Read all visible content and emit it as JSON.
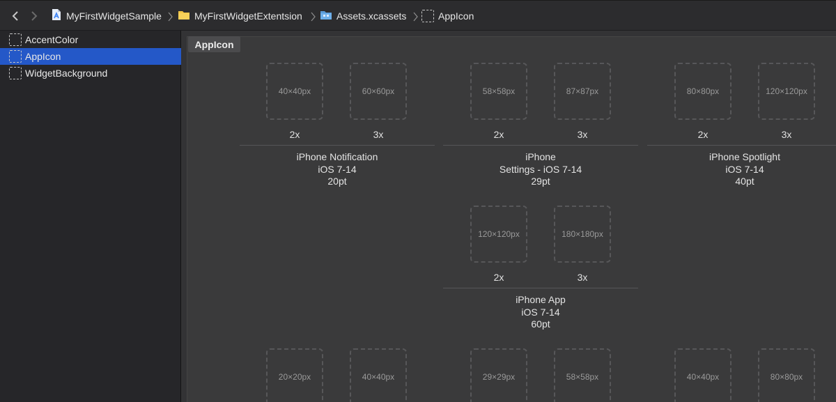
{
  "breadcrumb": {
    "items": [
      {
        "label": "MyFirstWidgetSample",
        "icon": "xcode-project-icon"
      },
      {
        "label": "MyFirstWidgetExtentsion",
        "icon": "folder-icon"
      },
      {
        "label": "Assets.xcassets",
        "icon": "asset-catalog-icon"
      },
      {
        "label": "AppIcon",
        "icon": "appicon-set-icon"
      }
    ]
  },
  "sidebar": {
    "items": [
      {
        "label": "AccentColor",
        "selected": false
      },
      {
        "label": "AppIcon",
        "selected": true
      },
      {
        "label": "WidgetBackground",
        "selected": false
      }
    ]
  },
  "main": {
    "set_title": "AppIcon",
    "groups": [
      {
        "line1": "iPhone Notification",
        "line2": "iOS 7-14",
        "line3": "20pt",
        "slots": [
          {
            "size": "40×40px",
            "scale": "2x"
          },
          {
            "size": "60×60px",
            "scale": "3x"
          }
        ]
      },
      {
        "line1": "iPhone",
        "line2": "Settings - iOS 7-14",
        "line3": "29pt",
        "slots": [
          {
            "size": "58×58px",
            "scale": "2x"
          },
          {
            "size": "87×87px",
            "scale": "3x"
          }
        ]
      },
      {
        "line1": "iPhone Spotlight",
        "line2": "iOS 7-14",
        "line3": "40pt",
        "slots": [
          {
            "size": "80×80px",
            "scale": "2x"
          },
          {
            "size": "120×120px",
            "scale": "3x"
          }
        ]
      },
      {
        "line1": "iPhone App",
        "line2": "iOS 7-14",
        "line3": "60pt",
        "slots": [
          {
            "size": "120×120px",
            "scale": "2x"
          },
          {
            "size": "180×180px",
            "scale": "3x"
          }
        ]
      }
    ],
    "bottom_slots": [
      "20×20px",
      "40×40px",
      "29×29px",
      "58×58px",
      "40×40px",
      "80×80px"
    ]
  }
}
